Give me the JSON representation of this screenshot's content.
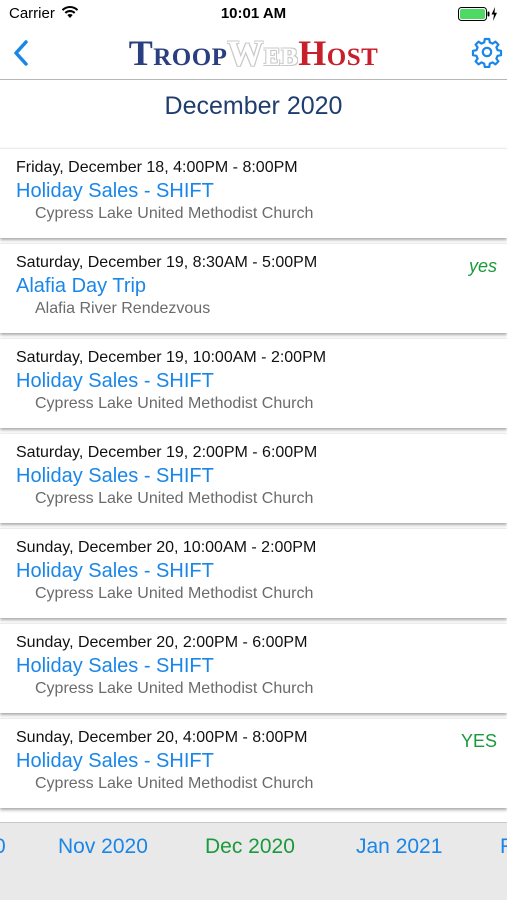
{
  "status_bar": {
    "carrier": "Carrier",
    "time": "10:01 AM",
    "icons": [
      "wifi-icon",
      "battery-icon",
      "charging-bolt-icon"
    ]
  },
  "nav": {
    "back_icon": "chevron-left-icon",
    "logo": {
      "troop": "Troop",
      "web": "Web",
      "host": "Host"
    },
    "settings_icon": "gear-icon"
  },
  "month_title": "December 2020",
  "events": [
    {
      "date": "Friday, December 18, 4:00PM - 8:00PM",
      "title": "Holiday Sales - SHIFT",
      "location": "Cypress Lake United Methodist Church",
      "rsvp": ""
    },
    {
      "date": "Saturday, December 19, 8:30AM - 5:00PM",
      "title": "Alafia Day Trip",
      "location": "Alafia River Rendezvous",
      "rsvp": "yes"
    },
    {
      "date": "Saturday, December 19, 10:00AM - 2:00PM",
      "title": "Holiday Sales - SHIFT",
      "location": "Cypress Lake United Methodist Church",
      "rsvp": ""
    },
    {
      "date": "Saturday, December 19, 2:00PM - 6:00PM",
      "title": "Holiday Sales - SHIFT",
      "location": "Cypress Lake United Methodist Church",
      "rsvp": ""
    },
    {
      "date": "Sunday, December 20, 10:00AM - 2:00PM",
      "title": "Holiday Sales - SHIFT",
      "location": "Cypress Lake United Methodist Church",
      "rsvp": ""
    },
    {
      "date": "Sunday, December 20, 2:00PM - 6:00PM",
      "title": "Holiday Sales - SHIFT",
      "location": "Cypress Lake United Methodist Church",
      "rsvp": ""
    },
    {
      "date": "Sunday, December 20, 4:00PM - 8:00PM",
      "title": "Holiday Sales - SHIFT",
      "location": "Cypress Lake United Methodist Church",
      "rsvp": "YES"
    }
  ],
  "month_selector": {
    "prev_partial": "0",
    "prev": "Nov 2020",
    "current": "Dec 2020",
    "next": "Jan 2021",
    "next_partial": "F"
  },
  "colors": {
    "link_blue": "#1a86e8",
    "rsvp_green": "#1a9a3a",
    "title_navy": "#1f3d6e",
    "logo_navy": "#2a3f80",
    "logo_red": "#c8202a"
  }
}
